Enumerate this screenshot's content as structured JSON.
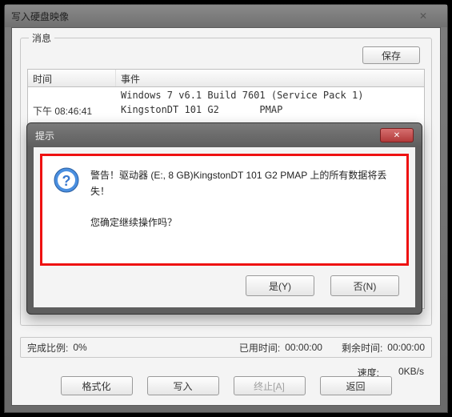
{
  "window": {
    "title": "写入硬盘映像"
  },
  "group": {
    "label": "消息",
    "save": "保存"
  },
  "log": {
    "headers": {
      "time": "时间",
      "event": "事件"
    },
    "rows": [
      {
        "time": "",
        "event": "Windows 7 v6.1 Build 7601 (Service Pack 1)"
      },
      {
        "time": "下午 08:46:41",
        "event": "KingstonDT 101 G2       PMAP"
      }
    ]
  },
  "stats": {
    "complete_label": "完成比例:",
    "complete_value": "0%",
    "elapsed_label": "已用时间:",
    "elapsed_value": "00:00:00",
    "remaining_label": "剩余时间:",
    "remaining_value": "00:00:00"
  },
  "speed": {
    "label": "速度:",
    "value": "0KB/s"
  },
  "buttons": {
    "format": "格式化",
    "write": "写入",
    "abort": "终止[A]",
    "back": "返回"
  },
  "modal": {
    "title": "提示",
    "warning_line1": "警告！驱动器 (E:, 8 GB)KingstonDT 101 G2       PMAP 上的所有数据将丢失！",
    "confirm_line": "您确定继续操作吗？",
    "yes": "是(Y)",
    "no": "否(N)"
  }
}
